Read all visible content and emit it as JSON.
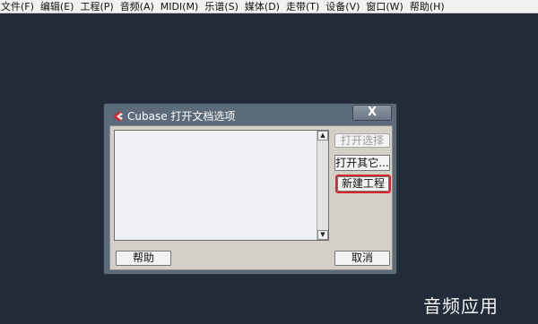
{
  "menubar": {
    "items": [
      "文件(F)",
      "编辑(E)",
      "工程(P)",
      "音频(A)",
      "MIDI(M)",
      "乐谱(S)",
      "媒体(D)",
      "走带(T)",
      "设备(V)",
      "窗口(W)",
      "帮助(H)"
    ]
  },
  "dialog": {
    "title": "Cubase 打开文档选项",
    "close_label": "X",
    "buttons": {
      "open_selected": "打开选择",
      "open_other": "打开其它...",
      "new_project": "新建工程",
      "help": "帮助",
      "cancel": "取消"
    },
    "list": {
      "items": []
    },
    "scroll_up": "▲",
    "scroll_down": "▼"
  },
  "colors": {
    "background": "#222b38",
    "dialog_frame": "#5c6b79",
    "highlight": "#d9262a"
  },
  "watermark": "音频应用"
}
